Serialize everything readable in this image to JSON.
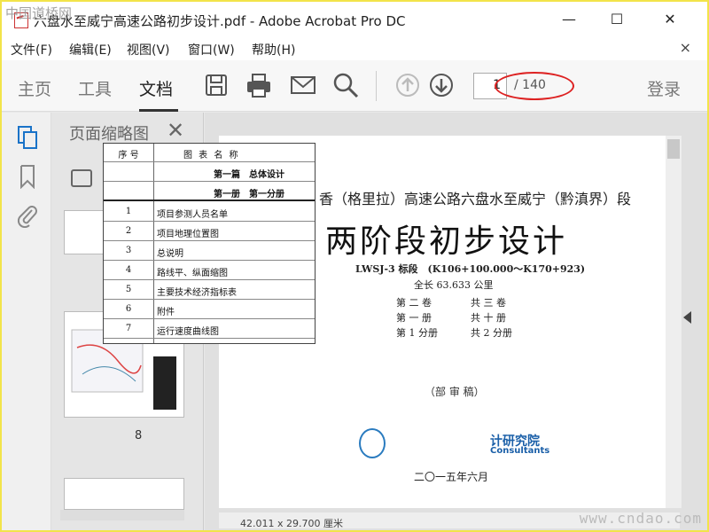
{
  "window": {
    "title": "六盘水至威宁高速公路初步设计.pdf - Adobe Acrobat Pro DC",
    "watermark_left": "中国道桥网",
    "minimize": "—",
    "maximize": "☐",
    "close": "✕"
  },
  "menu": {
    "items": [
      "文件(F)",
      "编辑(E)",
      "视图(V)",
      "窗口(W)",
      "帮助(H)"
    ],
    "close": "×"
  },
  "toolbar": {
    "tabs": [
      "主页",
      "工具",
      "文档"
    ],
    "active_tab": "文档",
    "page_current": "1",
    "page_total": "/ 140",
    "login": "登录",
    "icons": [
      "save-icon",
      "print-icon",
      "email-icon",
      "search-icon",
      "page-up-icon",
      "page-down-icon"
    ]
  },
  "thumbnails": {
    "title": "页面缩略图",
    "close": "✕",
    "page_number": "8"
  },
  "toc": {
    "header": [
      "序 号",
      "图 表 名 称"
    ],
    "sections": [
      "第一篇　总体设计",
      "第一册　第一分册"
    ],
    "rows": [
      [
        "1",
        "项目参测人员名单"
      ],
      [
        "2",
        "项目地理位置图"
      ],
      [
        "3",
        "总说明"
      ],
      [
        "4",
        "路线平、纵面缩图"
      ],
      [
        "5",
        "主要技术经济指标表"
      ],
      [
        "6",
        "附件"
      ],
      [
        "7",
        "运行速度曲线图"
      ]
    ]
  },
  "document": {
    "line1": "香（格里拉）高速公路六盘水至威宁（黔滇界）段",
    "main_title": "两阶段初步设计",
    "bid": "LWSJ-3 标段　(K106+100.000～K170+923)",
    "length": "全长 63.633 公里",
    "vol_left": [
      "第 二 卷",
      "第 一 册",
      "第 1 分册"
    ],
    "vol_right": [
      "共 三 卷",
      "共 十 册",
      "共 2 分册"
    ],
    "review": "（部 审 稿）",
    "institute": "计研究院",
    "consultants": "Consultants",
    "date": "二〇一五年六月",
    "page_size": "42.011 x 29.700 厘米"
  },
  "watermark_right": "www.cndao.com",
  "colors": {
    "frame": "#f2e44a",
    "ellipse": "#dd2222",
    "institute": "#1a5fa8"
  }
}
